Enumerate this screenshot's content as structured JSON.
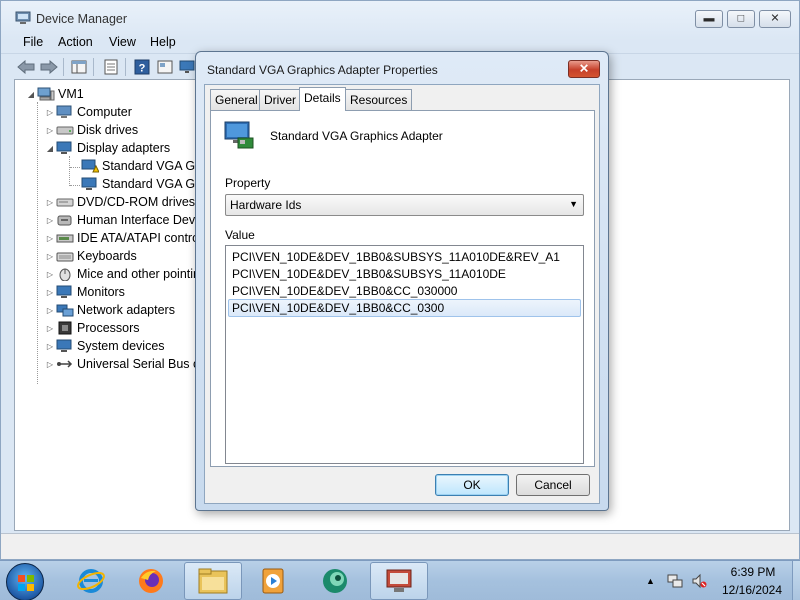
{
  "window": {
    "title": "Device Manager",
    "minimize_icon": "minimize-icon",
    "maximize_icon": "maximize-icon",
    "close_icon": "close-icon"
  },
  "menu": [
    "File",
    "Action",
    "View",
    "Help"
  ],
  "toolbar": {
    "icons": [
      "back-arrow-icon",
      "forward-arrow-icon",
      "console-tree-icon",
      "properties-icon",
      "help-icon",
      "view-icon",
      "monitor-icon"
    ]
  },
  "tree": {
    "root": "VM1",
    "items": [
      {
        "label": "Computer",
        "icon": "computer-icon",
        "expanded": false
      },
      {
        "label": "Disk drives",
        "icon": "disk-drive-icon",
        "expanded": false
      },
      {
        "label": "Display adapters",
        "icon": "display-adapter-icon",
        "expanded": true
      },
      {
        "label": "Standard VGA Grap",
        "icon": "warning-display-icon",
        "child": true
      },
      {
        "label": "Standard VGA Grap",
        "icon": "display-icon",
        "child": true
      },
      {
        "label": "DVD/CD-ROM drives",
        "icon": "dvd-icon",
        "expanded": false
      },
      {
        "label": "Human Interface Devic",
        "icon": "hid-icon",
        "expanded": false
      },
      {
        "label": "IDE ATA/ATAPI contro",
        "icon": "ide-icon",
        "expanded": false
      },
      {
        "label": "Keyboards",
        "icon": "keyboard-icon",
        "expanded": false
      },
      {
        "label": "Mice and other pointin",
        "icon": "mouse-icon",
        "expanded": false
      },
      {
        "label": "Monitors",
        "icon": "monitor-icon",
        "expanded": false
      },
      {
        "label": "Network adapters",
        "icon": "network-icon",
        "expanded": false
      },
      {
        "label": "Processors",
        "icon": "processor-icon",
        "expanded": false
      },
      {
        "label": "System devices",
        "icon": "system-icon",
        "expanded": false
      },
      {
        "label": "Universal Serial Bus co",
        "icon": "usb-icon",
        "expanded": false
      }
    ]
  },
  "dialog": {
    "title": "Standard VGA Graphics Adapter Properties",
    "tabs": [
      "General",
      "Driver",
      "Details",
      "Resources"
    ],
    "active_tab": "Details",
    "device_name": "Standard VGA Graphics Adapter",
    "property_label": "Property",
    "property_value": "Hardware Ids",
    "value_label": "Value",
    "values": [
      "PCI\\VEN_10DE&DEV_1BB0&SUBSYS_11A010DE&REV_A1",
      "PCI\\VEN_10DE&DEV_1BB0&SUBSYS_11A010DE",
      "PCI\\VEN_10DE&DEV_1BB0&CC_030000",
      "PCI\\VEN_10DE&DEV_1BB0&CC_0300"
    ],
    "selected_value_index": 3,
    "ok_label": "OK",
    "cancel_label": "Cancel"
  },
  "taskbar": {
    "items": [
      "internet-explorer-icon",
      "firefox-icon",
      "file-explorer-icon",
      "media-player-icon",
      "app-icon",
      "device-manager-icon"
    ],
    "clock_time": "6:39 PM",
    "clock_date": "12/16/2024",
    "tray_icons": [
      "show-hidden-icons-icon",
      "network-icon",
      "volume-muted-icon"
    ]
  },
  "colors": {
    "accent": "#3c7fb1",
    "selection": "#dbe9f9",
    "close_red": "#c6402a"
  }
}
